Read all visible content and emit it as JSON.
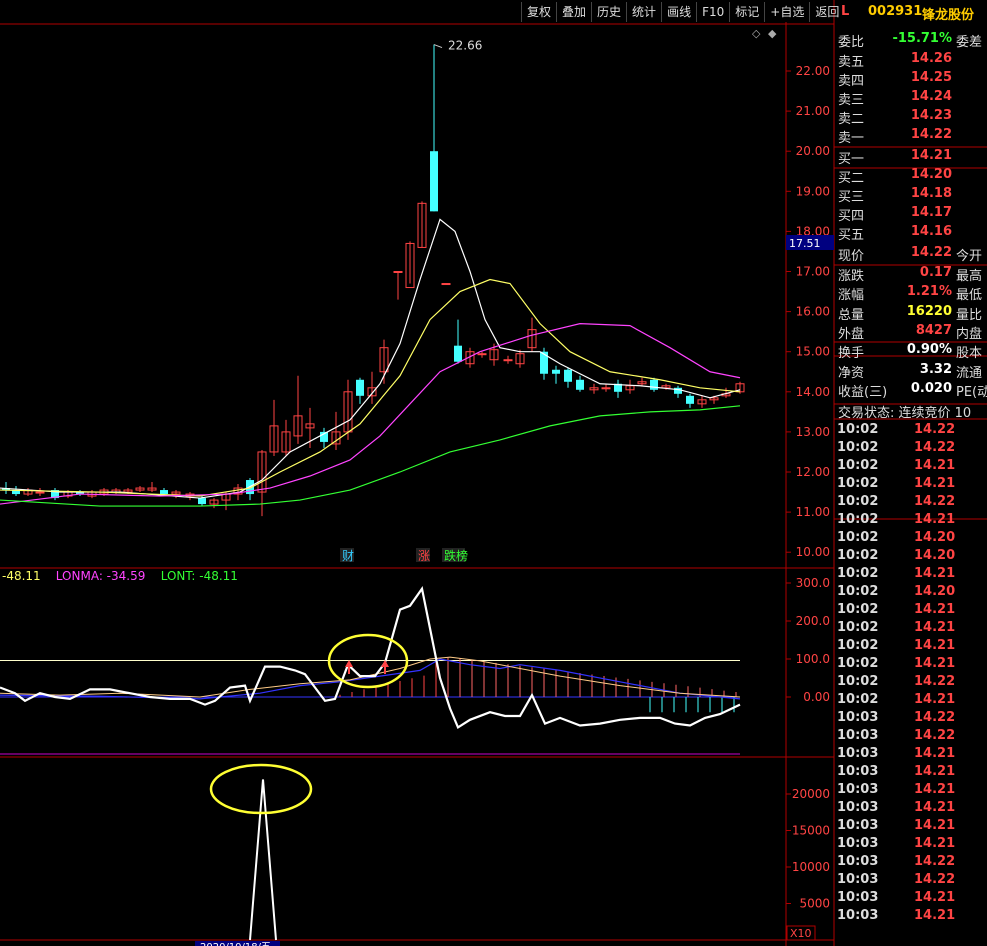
{
  "toolbar": {
    "items": [
      "复权",
      "叠加",
      "历史",
      "统计",
      "画线",
      "F10",
      "标记",
      "+自选",
      "返回"
    ]
  },
  "stock": {
    "flag": "L",
    "code": "002931",
    "name": "锋龙股份"
  },
  "main_chart": {
    "peak_label": "22.66",
    "current_price_tag": "17.51",
    "y_labels": [
      "22.00",
      "21.00",
      "20.00",
      "19.00",
      "18.00",
      "17.00",
      "16.00",
      "15.00",
      "14.00",
      "13.00",
      "12.00",
      "11.00",
      "10.00"
    ],
    "markers": [
      {
        "text": "财",
        "color": "#33ccff"
      },
      {
        "text": "涨",
        "color": "#ff4444"
      },
      {
        "text": "跌榜",
        "color": "#33ff33"
      }
    ]
  },
  "indicator": {
    "legend": [
      {
        "text": "-48.11",
        "color": "#ffff66"
      },
      {
        "text": "LONMA: -34.59",
        "color": "#ff44ff"
      },
      {
        "text": "LONT: -48.11",
        "color": "#33ff33"
      }
    ],
    "y_labels": [
      "300.0",
      "200.0",
      "100.0",
      "0.00"
    ]
  },
  "volume": {
    "y_labels": [
      "20000",
      "15000",
      "10000",
      "5000"
    ],
    "unit": "X10",
    "bottom_text": "2020/10/18/五"
  },
  "quote": {
    "weibi": {
      "label": "委比",
      "value": "-15.71%",
      "extra": "委差"
    },
    "sell": [
      {
        "label": "卖五",
        "price": "14.26"
      },
      {
        "label": "卖四",
        "price": "14.25"
      },
      {
        "label": "卖三",
        "price": "14.24"
      },
      {
        "label": "卖二",
        "price": "14.23"
      },
      {
        "label": "卖一",
        "price": "14.22"
      }
    ],
    "buy": [
      {
        "label": "买一",
        "price": "14.21"
      },
      {
        "label": "买二",
        "price": "14.20"
      },
      {
        "label": "买三",
        "price": "14.18"
      },
      {
        "label": "买四",
        "price": "14.17"
      },
      {
        "label": "买五",
        "price": "14.16"
      }
    ],
    "stats1": [
      {
        "label": "现价",
        "value": "14.22",
        "extra": "今开",
        "color": "red"
      },
      {
        "label": "涨跌",
        "value": "0.17",
        "extra": "最高",
        "color": "red"
      },
      {
        "label": "涨幅",
        "value": "1.21%",
        "extra": "最低",
        "color": "red"
      },
      {
        "label": "总量",
        "value": "16220",
        "extra": "量比",
        "color": "yel"
      },
      {
        "label": "外盘",
        "value": "8427",
        "extra": "内盘",
        "color": "red"
      }
    ],
    "stats2": [
      {
        "label": "换手",
        "value": "0.90%",
        "extra": "股本"
      },
      {
        "label": "净资",
        "value": "3.32",
        "extra": "流通"
      },
      {
        "label": "收益(三)",
        "value": "0.020",
        "extra": "PE(动"
      }
    ],
    "trade_status": "交易状态: 连续竞价 10"
  },
  "ticks": [
    {
      "time": "10:02",
      "price": "14.22"
    },
    {
      "time": "10:02",
      "price": "14.22"
    },
    {
      "time": "10:02",
      "price": "14.21"
    },
    {
      "time": "10:02",
      "price": "14.21"
    },
    {
      "time": "10:02",
      "price": "14.22"
    },
    {
      "time": "10:02",
      "price": "14.21"
    },
    {
      "time": "10:02",
      "price": "14.20"
    },
    {
      "time": "10:02",
      "price": "14.20"
    },
    {
      "time": "10:02",
      "price": "14.21"
    },
    {
      "time": "10:02",
      "price": "14.20"
    },
    {
      "time": "10:02",
      "price": "14.21"
    },
    {
      "time": "10:02",
      "price": "14.21"
    },
    {
      "time": "10:02",
      "price": "14.21"
    },
    {
      "time": "10:02",
      "price": "14.21"
    },
    {
      "time": "10:02",
      "price": "14.22"
    },
    {
      "time": "10:02",
      "price": "14.21"
    },
    {
      "time": "10:03",
      "price": "14.22"
    },
    {
      "time": "10:03",
      "price": "14.22"
    },
    {
      "time": "10:03",
      "price": "14.21"
    },
    {
      "time": "10:03",
      "price": "14.21"
    },
    {
      "time": "10:03",
      "price": "14.21"
    },
    {
      "time": "10:03",
      "price": "14.21"
    },
    {
      "time": "10:03",
      "price": "14.21"
    },
    {
      "time": "10:03",
      "price": "14.21"
    },
    {
      "time": "10:03",
      "price": "14.22"
    },
    {
      "time": "10:03",
      "price": "14.22"
    },
    {
      "time": "10:03",
      "price": "14.21"
    },
    {
      "time": "10:03",
      "price": "14.21"
    }
  ]
}
